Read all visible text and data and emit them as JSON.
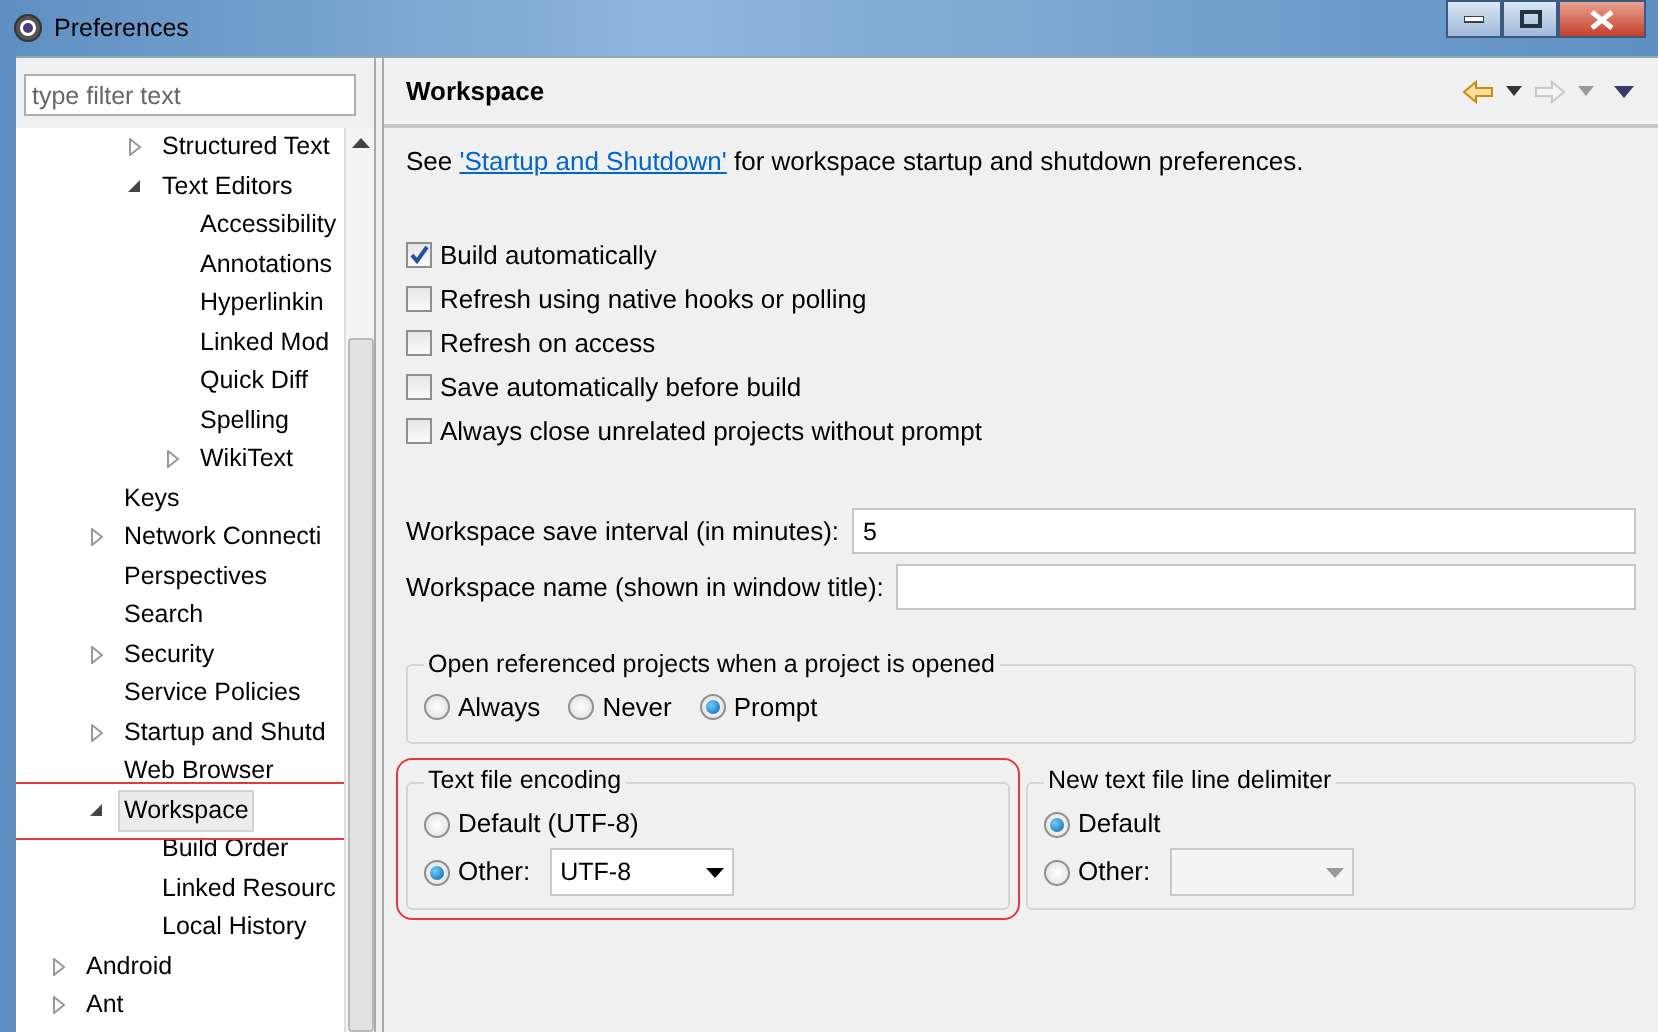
{
  "window": {
    "title": "Preferences"
  },
  "filter": {
    "placeholder": "type filter text"
  },
  "tree": [
    {
      "children": [
        {
          "children": [
            {
              "label": "Structured Text",
              "expanded": false,
              "selected": false
            },
            {
              "label": "Text Editors",
              "expanded": true,
              "selected": false,
              "children": [
                {
                  "label": "Accessibility",
                  "selected": false
                },
                {
                  "label": "Annotations",
                  "selected": false
                },
                {
                  "label": "Hyperlinkin",
                  "selected": false
                },
                {
                  "label": "Linked Mod",
                  "selected": false
                },
                {
                  "label": "Quick Diff",
                  "selected": false
                },
                {
                  "label": "Spelling",
                  "selected": false
                },
                {
                  "label": "WikiText",
                  "expanded": false,
                  "selected": false
                }
              ]
            }
          ]
        },
        {
          "label": "Keys",
          "selected": false
        },
        {
          "label": "Network Connecti",
          "expanded": false,
          "selected": false
        },
        {
          "label": "Perspectives",
          "selected": false
        },
        {
          "label": "Search",
          "selected": false
        },
        {
          "label": "Security",
          "expanded": false,
          "selected": false
        },
        {
          "label": "Service Policies",
          "selected": false
        },
        {
          "label": "Startup and Shutd",
          "expanded": false,
          "selected": false
        },
        {
          "label": "Web Browser",
          "selected": false
        },
        {
          "label": "Workspace",
          "expanded": true,
          "selected": true,
          "annotated": true,
          "children": [
            {
              "label": "Build Order",
              "selected": false
            },
            {
              "label": "Linked Resourc",
              "selected": false
            },
            {
              "label": "Local History",
              "selected": false
            }
          ]
        }
      ]
    },
    {
      "label": "Android",
      "expanded": false,
      "selected": false
    },
    {
      "label": "Ant",
      "expanded": false,
      "selected": false
    }
  ],
  "page": {
    "title": "Workspace",
    "intro": {
      "before": "See ",
      "link": "'Startup and Shutdown'",
      "after": " for workspace startup and shutdown preferences."
    },
    "options": [
      {
        "label": "Build automatically",
        "checked": true
      },
      {
        "label": "Refresh using native hooks or polling",
        "checked": false
      },
      {
        "label": "Refresh on access",
        "checked": false
      },
      {
        "label": "Save automatically before build",
        "checked": false
      },
      {
        "label": "Always close unrelated projects without prompt",
        "checked": false
      }
    ],
    "fields": [
      {
        "label": "Workspace save interval (in minutes):",
        "value": "5"
      },
      {
        "label": "Workspace name (shown in window title):"
      }
    ],
    "open_group": {
      "title": "Open referenced projects when a project is opened",
      "options": [
        {
          "label": "Always",
          "selected": false
        },
        {
          "label": "Never",
          "selected": false
        },
        {
          "label": "Prompt",
          "selected": true
        }
      ]
    },
    "encoding": {
      "title": "Text file encoding",
      "annotated": true,
      "options": [
        {
          "label": "Default (UTF-8)",
          "selected": false
        },
        {
          "label": "Other:",
          "selected": true,
          "combo": {
            "value": "UTF-8",
            "disabled": false
          }
        }
      ]
    },
    "delimiter": {
      "title": "New text file line delimiter",
      "options": [
        {
          "label": "Default",
          "selected": true
        },
        {
          "label": "Other:",
          "selected": false,
          "combo": {
            "disabled": true
          }
        }
      ]
    }
  }
}
